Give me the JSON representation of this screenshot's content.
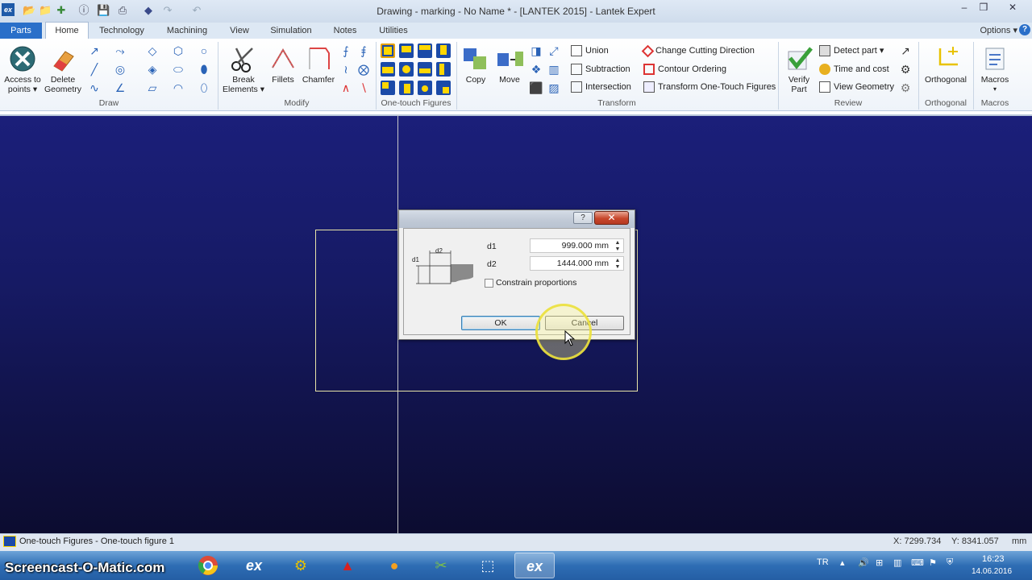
{
  "window": {
    "title": "Drawing - marking - No Name * - [LANTEK 2015] - Lantek Expert",
    "app_icon": "ex"
  },
  "quick_access": [
    "open-folder-icon",
    "folder-icon",
    "new-file-icon",
    "info-icon",
    "save-icon",
    "print-preview-icon",
    "back-icon",
    "redo-icon",
    "undo-icon"
  ],
  "window_buttons": {
    "minimize": "–",
    "restore": "❒",
    "close": "✕"
  },
  "tabs": {
    "parts": "Parts",
    "items": [
      "Home",
      "Technology",
      "Machining",
      "View",
      "Simulation",
      "Notes",
      "Utilities"
    ],
    "active": "Home",
    "options": "Options",
    "help": "?"
  },
  "ribbon": {
    "draw": {
      "access_points": [
        "Access to",
        "points ▾"
      ],
      "delete_geometry": [
        "Delete",
        "Geometry"
      ],
      "label": "Draw"
    },
    "modify": {
      "break_elements": [
        "Break",
        "Elements ▾"
      ],
      "fillets": "Fillets",
      "chamfer": "Chamfer",
      "label": "Modify"
    },
    "one_touch": {
      "label": "One-touch Figures"
    },
    "transform": {
      "copy": "Copy",
      "move": "Move",
      "union": "Union",
      "subtraction": "Subtraction",
      "intersection": "Intersection",
      "change_cutting": "Change Cutting Direction",
      "contour_ordering": "Contour Ordering",
      "transform_figures": "Transform One-Touch Figures",
      "label": "Transform"
    },
    "review": {
      "verify": [
        "Verify",
        "Part"
      ],
      "detect_part": "Detect part ▾",
      "time_cost": "Time and cost",
      "view_geometry": "View Geometry",
      "label": "Review"
    },
    "orthogonal": {
      "btn": "Orthogonal",
      "label": "Orthogonal"
    },
    "macros": {
      "btn": "Macros",
      "label": "Macros"
    }
  },
  "dialog": {
    "help": "?",
    "close": "✕",
    "diagram": {
      "d1": "d1",
      "d2": "d2"
    },
    "d1_label": "d1",
    "d1_value": "999.000 mm",
    "d2_label": "d2",
    "d2_value": "1444.000 mm",
    "constrain": "Constrain proportions",
    "ok": "OK",
    "cancel": "Cancel"
  },
  "status": {
    "text": "One-touch Figures - One-touch figure 1",
    "x": "X: 7299.734",
    "y": "Y: 8341.057",
    "units": "mm"
  },
  "taskbar": {
    "watermark": "Screencast-O-Matic.com",
    "apps": [
      "chrome-icon",
      "lantek-expert-icon",
      "nc-app-icon",
      "acrobat-icon",
      "paint-icon",
      "snipping-icon",
      "screen-capture-icon",
      "lantek-expert-active-icon"
    ],
    "app_text": "ex",
    "lang": "TR",
    "time": "16:23",
    "date": "14.06.2016"
  }
}
